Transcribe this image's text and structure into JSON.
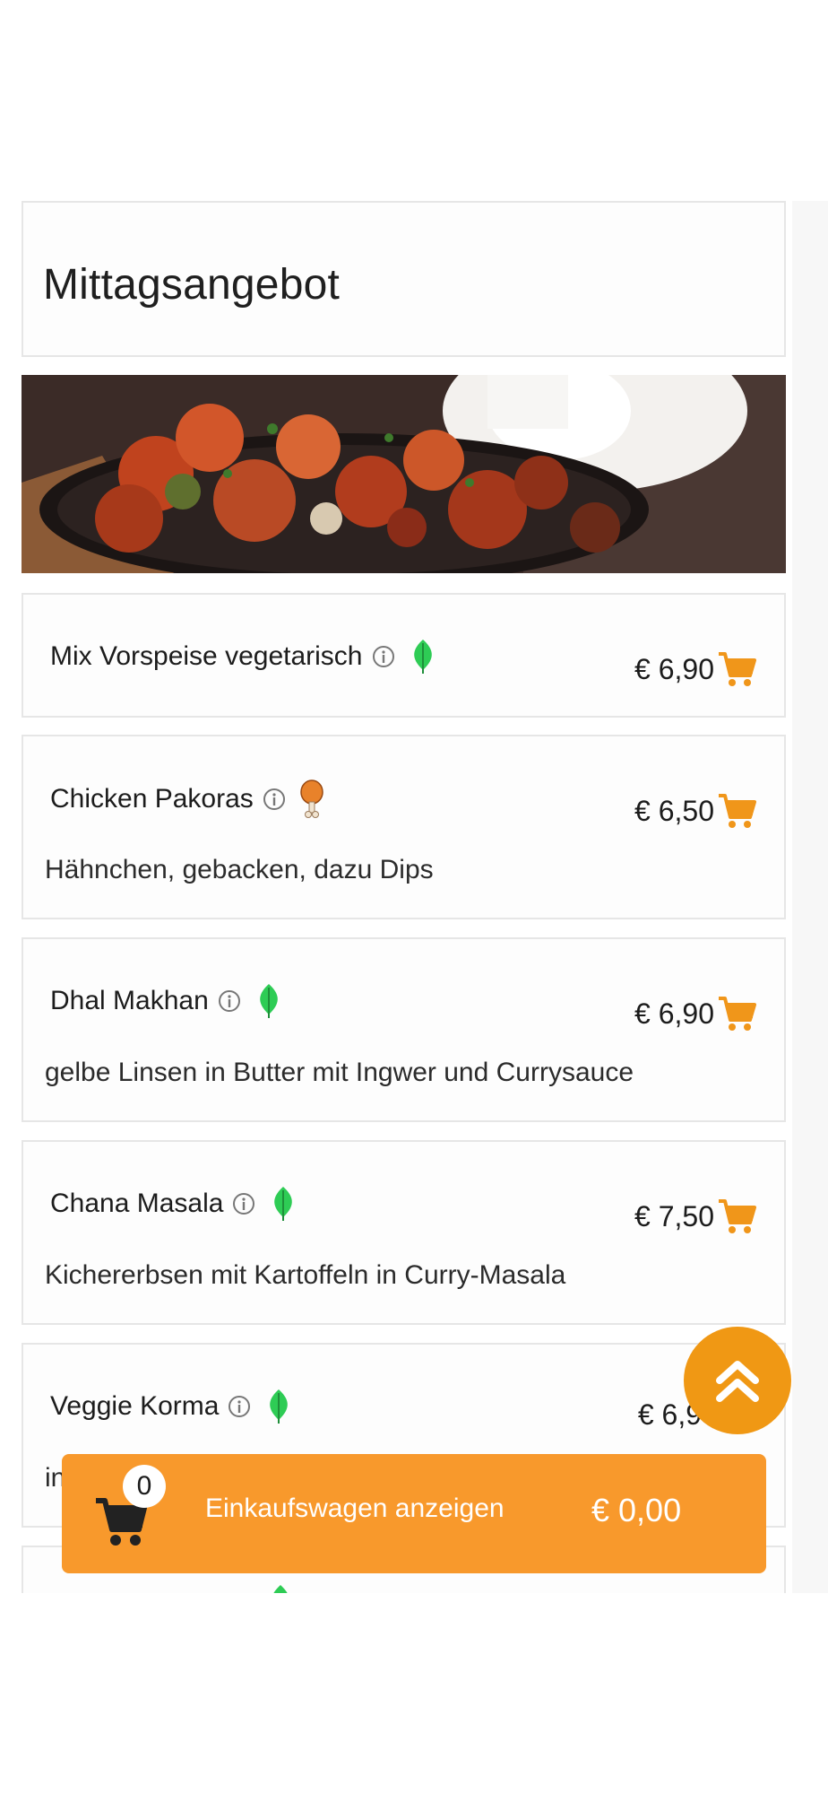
{
  "section": {
    "title": "Mittagsangebot"
  },
  "items": [
    {
      "name": "Mix Vorspeise vegetarisch",
      "description": "",
      "price": "€ 6,90",
      "diet_icon": "leaf-icon"
    },
    {
      "name": "Chicken Pakoras",
      "description": "Hähnchen, gebacken, dazu Dips",
      "price": "€ 6,50",
      "diet_icon": "chicken-leg-icon"
    },
    {
      "name": "Dhal Makhan",
      "description": "gelbe Linsen in Butter mit Ingwer und Currysauce",
      "price": "€ 6,90",
      "diet_icon": "leaf-icon"
    },
    {
      "name": "Chana Masala",
      "description": "Kichererbsen mit Kartoffeln in Curry-Masala",
      "price": "€ 7,50",
      "diet_icon": "leaf-icon"
    },
    {
      "name": "Veggie Korma",
      "description": "in",
      "price": "€ 6,9",
      "diet_icon": "leaf-icon"
    }
  ],
  "cart": {
    "count": "0",
    "label": "Einkaufswagen anzeigen",
    "total": "€ 0,00"
  },
  "colors": {
    "accent_orange": "#f8992c",
    "scroll_button": "#f09814",
    "leaf_green": "#2ecc55",
    "chicken_orange": "#e8822a"
  }
}
